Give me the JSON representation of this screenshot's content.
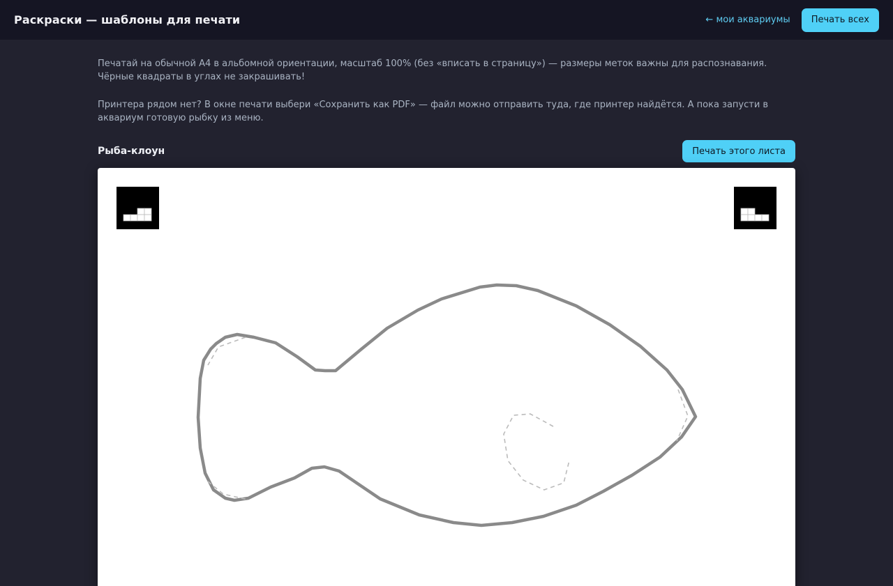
{
  "header": {
    "title": "Раскраски — шаблоны для печати",
    "back_link": "← мои аквариумы",
    "print_all_label": "Печать всех"
  },
  "intro": {
    "line1": "Печатай на обычной А4 в альбомной ориентации, масштаб 100% (без «вписать в страницу») — размеры меток важны для распознавания. Чёрные квадраты в углах не закрашивать!",
    "line2": "Принтера рядом нет? В окне печати выбери «Сохранить как PDF» — файл можно отправить туда, где принтер найдётся. А пока запусти в аквариум готовую рыбку из меню."
  },
  "sheets": [
    {
      "title": "Рыба-клоун",
      "print_label": "Печать этого листа"
    }
  ],
  "colors": {
    "background": "#22222f",
    "topbar": "#151523",
    "accent": "#4fd0f7",
    "link": "#5ecbf0",
    "outline": "#888888",
    "guide": "#bbbbbb"
  },
  "icons": {
    "back": "left-arrow",
    "marker": "fiducial-marker"
  }
}
